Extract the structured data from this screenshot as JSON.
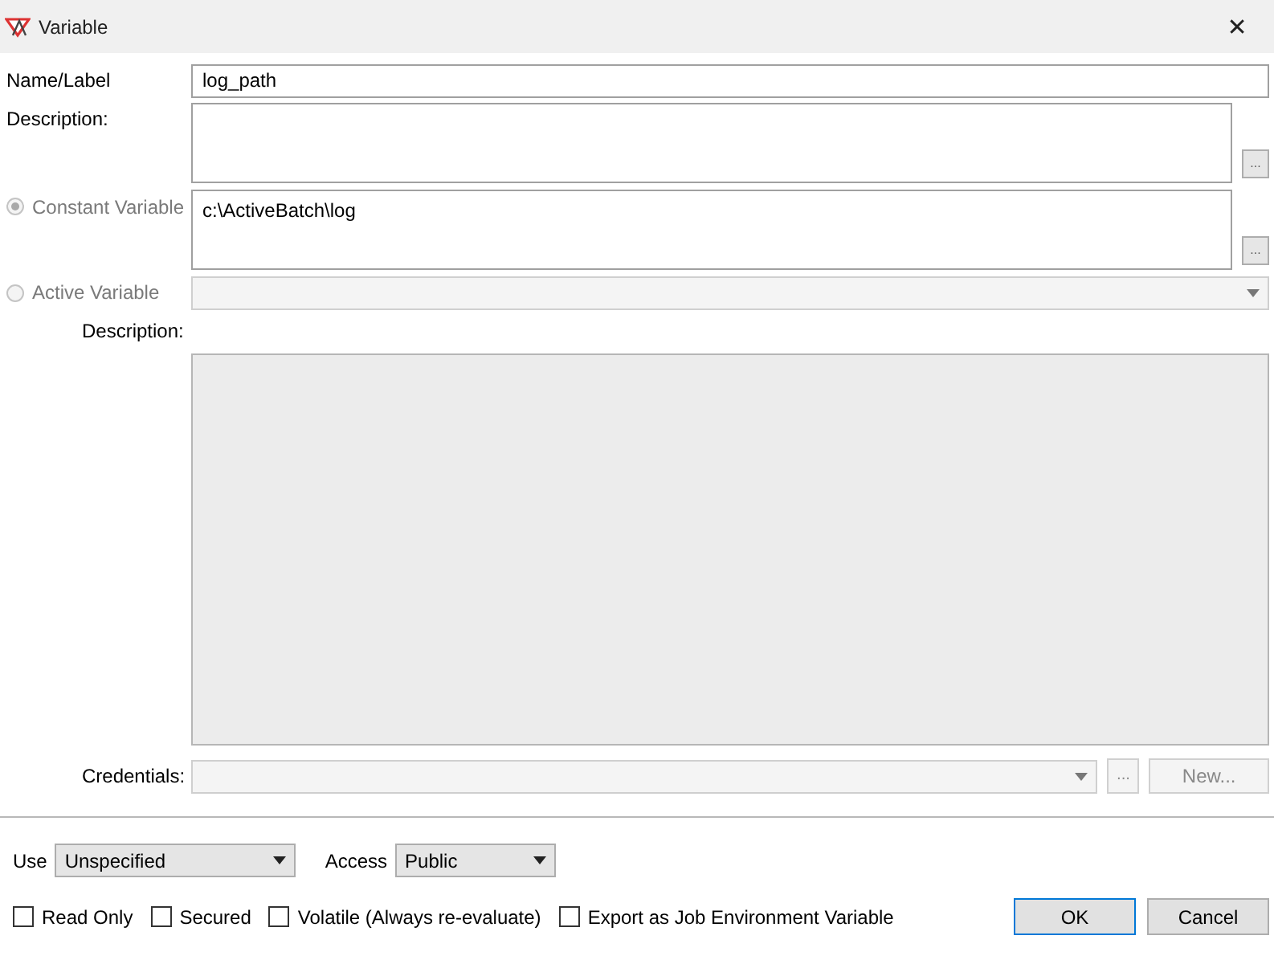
{
  "window": {
    "title": "Variable",
    "close": "✕"
  },
  "name_label": {
    "label": "Name/Label",
    "value": "log_path"
  },
  "description": {
    "label": "Description:",
    "browse": "..."
  },
  "modes": [
    {
      "label": "Constant Variable",
      "selected": true,
      "disabled": true,
      "value": "c:\\ActiveBatch\\log",
      "browse": "..."
    },
    {
      "label": "Active Variable",
      "selected": false,
      "disabled": true
    }
  ],
  "active_description": {
    "label": "Description:"
  },
  "credentials": {
    "label": "Credentials:",
    "browse": "...",
    "new_button": "New..."
  },
  "use": {
    "label": "Use",
    "value": "Unspecified"
  },
  "access": {
    "label": "Access",
    "value": "Public"
  },
  "options": [
    {
      "label": "Read Only",
      "checked": false
    },
    {
      "label": "Secured",
      "checked": false
    },
    {
      "label": "Volatile (Always re-evaluate)",
      "checked": false
    },
    {
      "label": "Export as Job Environment Variable",
      "checked": false
    }
  ],
  "buttons": [
    {
      "label": "OK",
      "default": true
    },
    {
      "label": "Cancel",
      "default": false
    }
  ]
}
